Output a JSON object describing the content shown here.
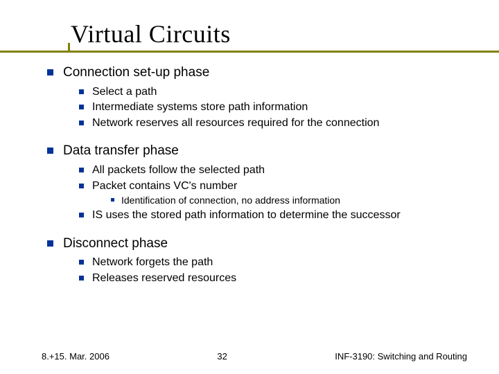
{
  "title": "Virtual Circuits",
  "sections": [
    {
      "heading": "Connection set-up phase",
      "items": [
        {
          "text": "Select a path"
        },
        {
          "text": "Intermediate systems store path information"
        },
        {
          "text": "Network reserves all resources required for the connection"
        }
      ]
    },
    {
      "heading": "Data transfer phase",
      "items": [
        {
          "text": "All packets follow the selected path"
        },
        {
          "text": "Packet contains VC's number",
          "sub": [
            {
              "text": "Identification of connection, no address information"
            }
          ]
        },
        {
          "text": "IS uses the stored path information to determine the successor"
        }
      ]
    },
    {
      "heading": "Disconnect phase",
      "items": [
        {
          "text": "Network forgets the path"
        },
        {
          "text": "Releases reserved resources"
        }
      ]
    }
  ],
  "footer": {
    "date": "8.+15. Mar. 2006",
    "page": "32",
    "course": "INF-3190: Switching and Routing"
  }
}
